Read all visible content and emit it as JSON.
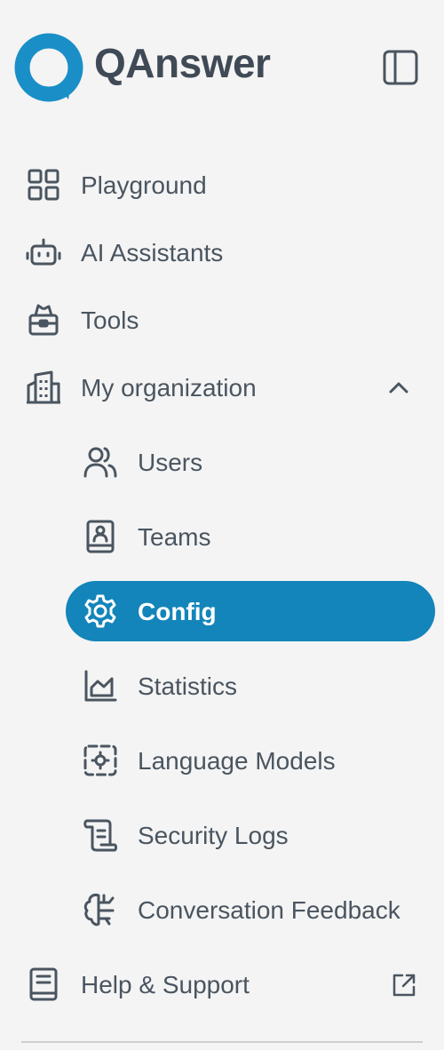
{
  "brand": {
    "name": "QAnswer",
    "logo_color": "#1a8fc7"
  },
  "header": {
    "collapse_icon": "sidebar-panel-icon"
  },
  "nav": {
    "items": [
      {
        "label": "Playground",
        "icon": "grid-icon"
      },
      {
        "label": "AI Assistants",
        "icon": "robot-icon"
      },
      {
        "label": "Tools",
        "icon": "toolbox-icon"
      },
      {
        "label": "My organization",
        "icon": "building-icon",
        "expanded": true
      }
    ],
    "org_items": [
      {
        "label": "Users",
        "icon": "users-icon"
      },
      {
        "label": "Teams",
        "icon": "contact-book-icon"
      },
      {
        "label": "Config",
        "icon": "gear-icon",
        "active": true
      },
      {
        "label": "Statistics",
        "icon": "chart-icon"
      },
      {
        "label": "Language Models",
        "icon": "cpu-icon"
      },
      {
        "label": "Security Logs",
        "icon": "scroll-icon"
      },
      {
        "label": "Conversation Feedback",
        "icon": "brain-icon"
      }
    ],
    "footer": {
      "label": "Help & Support",
      "icon": "book-icon",
      "external": true
    }
  },
  "theme": {
    "accent": "#1385ba",
    "text": "#4a5560",
    "background": "#f4f4f4"
  }
}
